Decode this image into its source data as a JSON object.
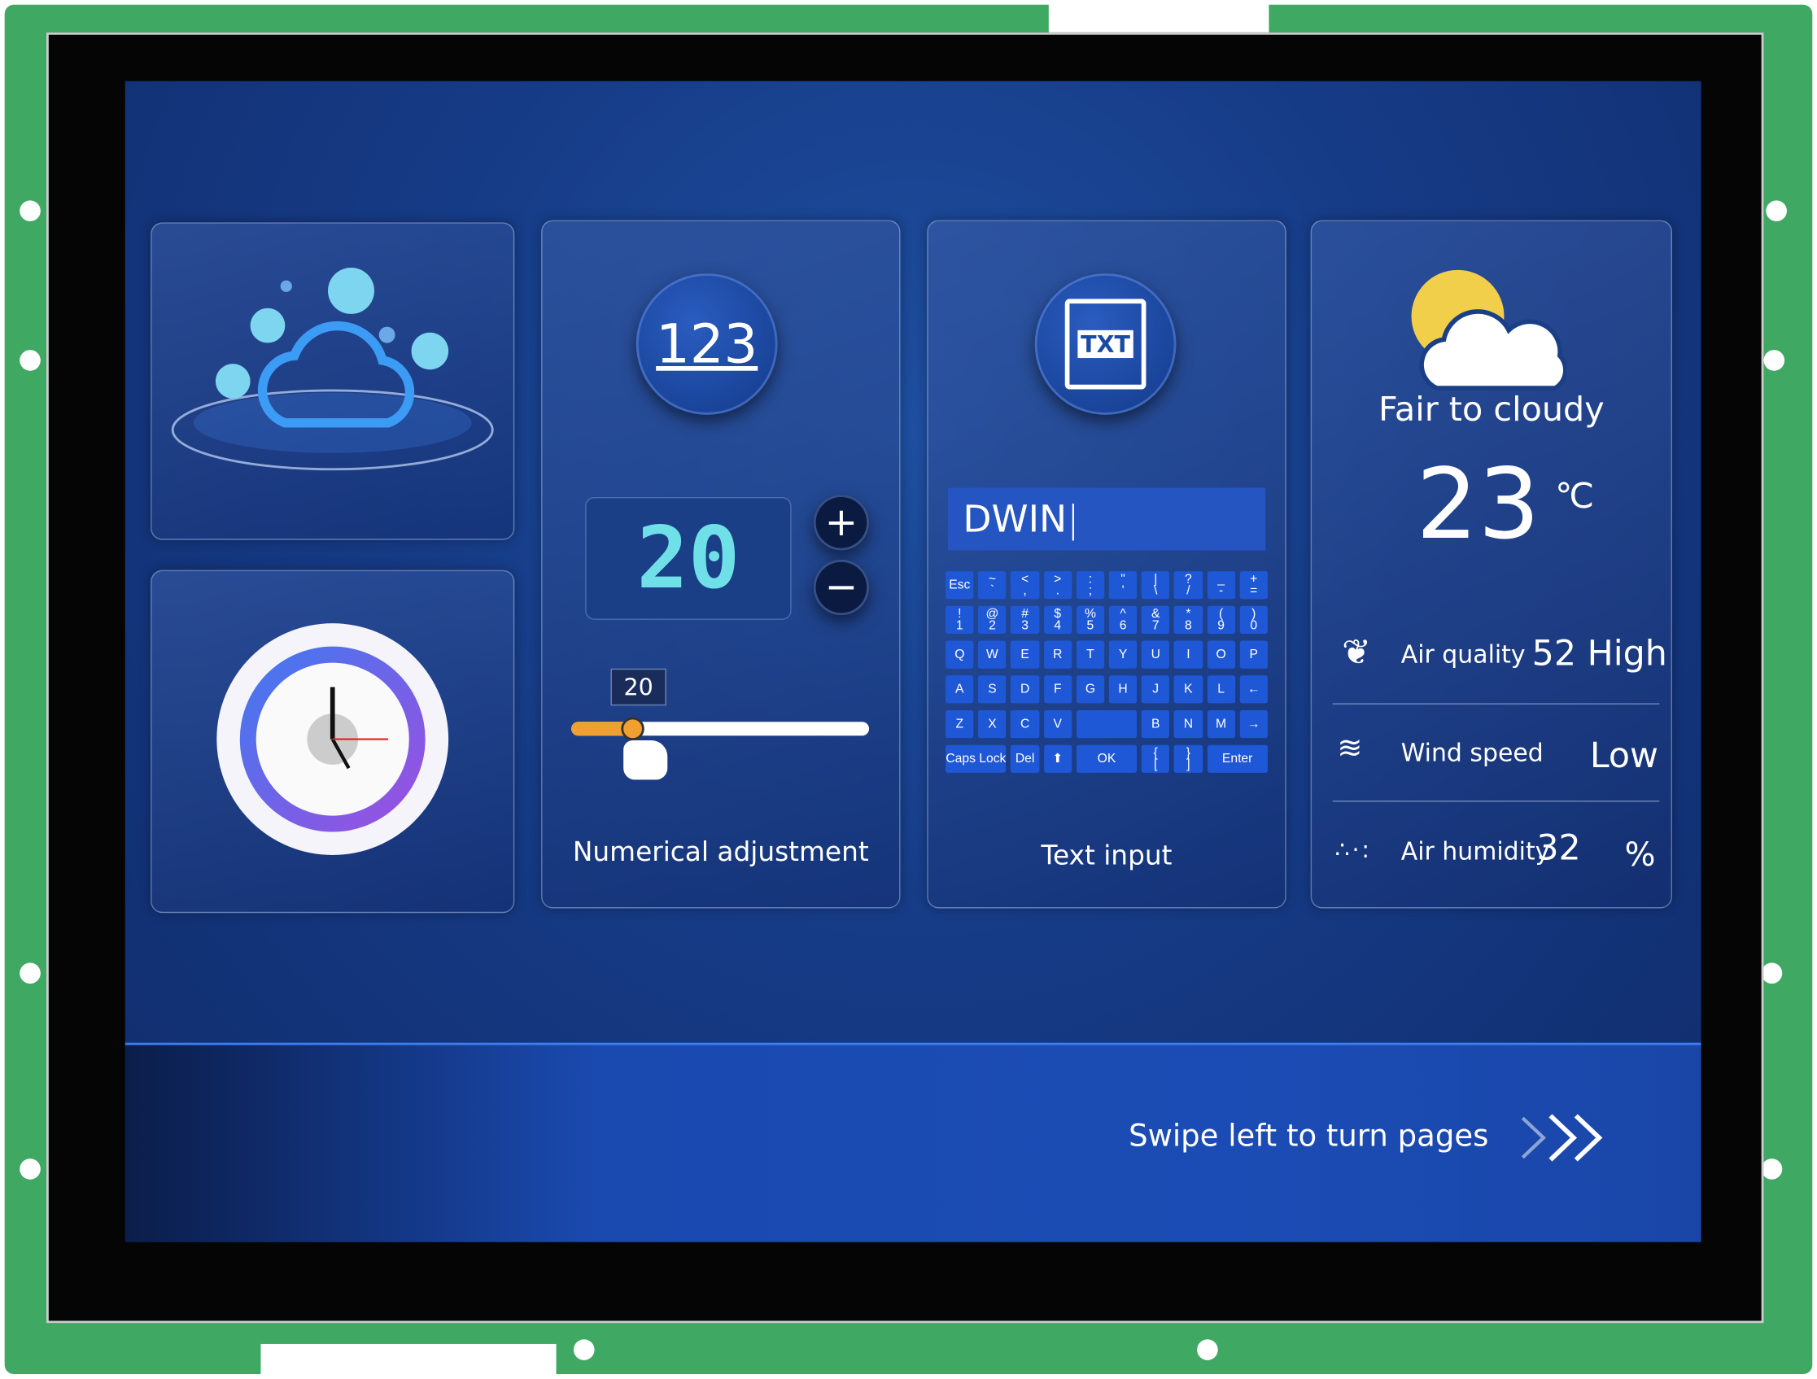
{
  "colors": {
    "pcb": "#3fa863",
    "screen": "#163b86",
    "key": "#1f58d6",
    "accent_orange": "#f0a030"
  },
  "number_card": {
    "icon_text": "123",
    "display_value": "20",
    "slider_value": "20",
    "slider_fraction": 0.2,
    "plus": "+",
    "minus": "−",
    "label": "Numerical adjustment"
  },
  "text_card": {
    "icon_text": "TXT",
    "input_value": "DWIN",
    "label": "Text input",
    "keys": [
      [
        {
          "t": "Esc"
        },
        {
          "t": "~",
          "b": "`"
        },
        {
          "t": "<",
          "b": ","
        },
        {
          "t": ">",
          "b": "."
        },
        {
          "t": ":",
          "b": ";"
        },
        {
          "t": "\"",
          "b": "'"
        },
        {
          "t": "|",
          "b": "\\"
        },
        {
          "t": "?",
          "b": "/"
        },
        {
          "t": "_",
          "b": "-"
        },
        {
          "t": "+",
          "b": "="
        }
      ],
      [
        {
          "t": "!",
          "b": "1"
        },
        {
          "t": "@",
          "b": "2"
        },
        {
          "t": "#",
          "b": "3"
        },
        {
          "t": "$",
          "b": "4"
        },
        {
          "t": "%",
          "b": "5"
        },
        {
          "t": "^",
          "b": "6"
        },
        {
          "t": "&",
          "b": "7"
        },
        {
          "t": "*",
          "b": "8"
        },
        {
          "t": "(",
          "b": "9"
        },
        {
          "t": ")",
          "b": "0"
        }
      ],
      [
        {
          "t": "Q"
        },
        {
          "t": "W"
        },
        {
          "t": "E"
        },
        {
          "t": "R"
        },
        {
          "t": "T"
        },
        {
          "t": "Y"
        },
        {
          "t": "U"
        },
        {
          "t": "I"
        },
        {
          "t": "O"
        },
        {
          "t": "P"
        }
      ],
      [
        {
          "t": "A"
        },
        {
          "t": "S"
        },
        {
          "t": "D"
        },
        {
          "t": "F"
        },
        {
          "t": "G"
        },
        {
          "t": "H"
        },
        {
          "t": "J"
        },
        {
          "t": "K"
        },
        {
          "t": "L"
        },
        {
          "t": "←"
        }
      ],
      [
        {
          "t": "Z"
        },
        {
          "t": "X"
        },
        {
          "t": "C"
        },
        {
          "t": "V"
        },
        {
          "t": "",
          "span": 2
        },
        {
          "t": "B"
        },
        {
          "t": "N"
        },
        {
          "t": "M"
        },
        {
          "t": "→"
        }
      ],
      [
        {
          "t": "Caps Lock",
          "span": 2
        },
        {
          "t": "Del"
        },
        {
          "t": "⬆"
        },
        {
          "t": "OK",
          "span": 2
        },
        {
          "t": "{",
          "b": "["
        },
        {
          "t": "}",
          "b": "]"
        },
        {
          "t": "Enter",
          "span": 2
        }
      ]
    ]
  },
  "weather_card": {
    "condition": "Fair to cloudy",
    "temperature": "23",
    "unit": "℃",
    "rows": [
      {
        "label": "Air quality",
        "value": "52 High"
      },
      {
        "label": "Wind speed",
        "value": "Low"
      },
      {
        "label": "Air humidity",
        "value": "32",
        "unit": "%"
      }
    ]
  },
  "footer": {
    "swipe_text": "Swipe left to turn pages"
  }
}
